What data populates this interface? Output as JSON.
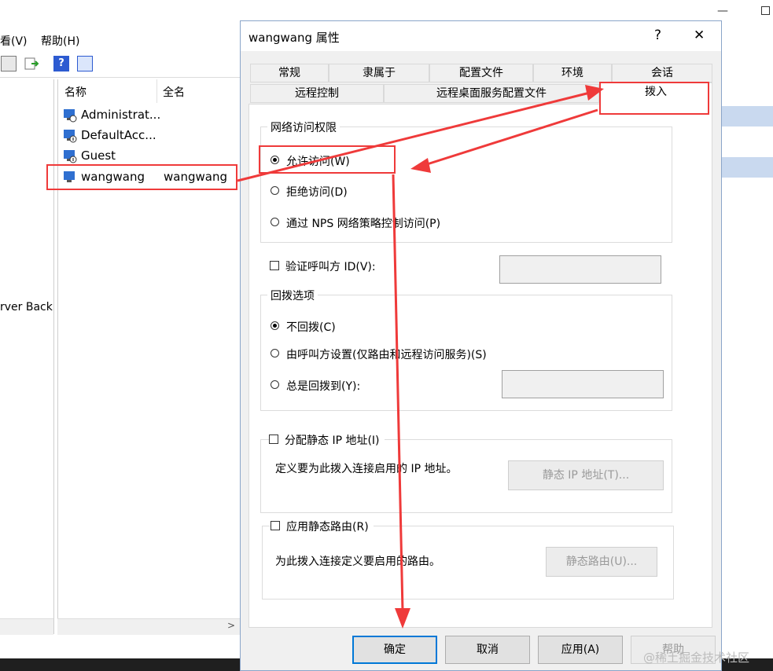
{
  "background": {
    "menu": [
      "看(V)",
      "帮助(H)"
    ],
    "tree_partial": [
      "rver Back"
    ],
    "list": {
      "columns": [
        "名称",
        "全名"
      ],
      "rows": [
        {
          "name": "Administrat...",
          "full": ""
        },
        {
          "name": "DefaultAcc...",
          "full": ""
        },
        {
          "name": "Guest",
          "full": ""
        },
        {
          "name": "wangwang",
          "full": "wangwang"
        }
      ]
    }
  },
  "dialog": {
    "title": "wangwang 属性",
    "help_glyph": "?",
    "close_glyph": "✕",
    "tabs_row1": [
      "常规",
      "隶属于",
      "配置文件",
      "环境",
      "会话"
    ],
    "tabs_row2": [
      "远程控制",
      "远程桌面服务配置文件",
      "拨入"
    ],
    "active_tab": "拨入",
    "network_access": {
      "title": "网络访问权限",
      "options": [
        "允许访问(W)",
        "拒绝访问(D)",
        "通过 NPS 网络策略控制访问(P)"
      ],
      "selected": 0
    },
    "verify_caller": {
      "label": "验证呼叫方 ID(V):",
      "checked": false,
      "value": ""
    },
    "callback": {
      "title": "回拨选项",
      "options": [
        "不回拨(C)",
        "由呼叫方设置(仅路由和远程访问服务)(S)",
        "总是回拨到(Y):"
      ],
      "selected": 0,
      "number_value": ""
    },
    "static_ip": {
      "label": "分配静态 IP 地址(I)",
      "checked": false,
      "description": "定义要为此拨入连接启用的 IP 地址。",
      "button": "静态 IP 地址(T)..."
    },
    "static_route": {
      "label": "应用静态路由(R)",
      "checked": false,
      "description": "为此拨入连接定义要启用的路由。",
      "button": "静态路由(U)..."
    },
    "buttons": {
      "ok": "确定",
      "cancel": "取消",
      "apply": "应用(A)",
      "help": "帮助"
    }
  },
  "annotation_color": "#ef3a3a",
  "watermark": "@稀土掘金技术社区"
}
